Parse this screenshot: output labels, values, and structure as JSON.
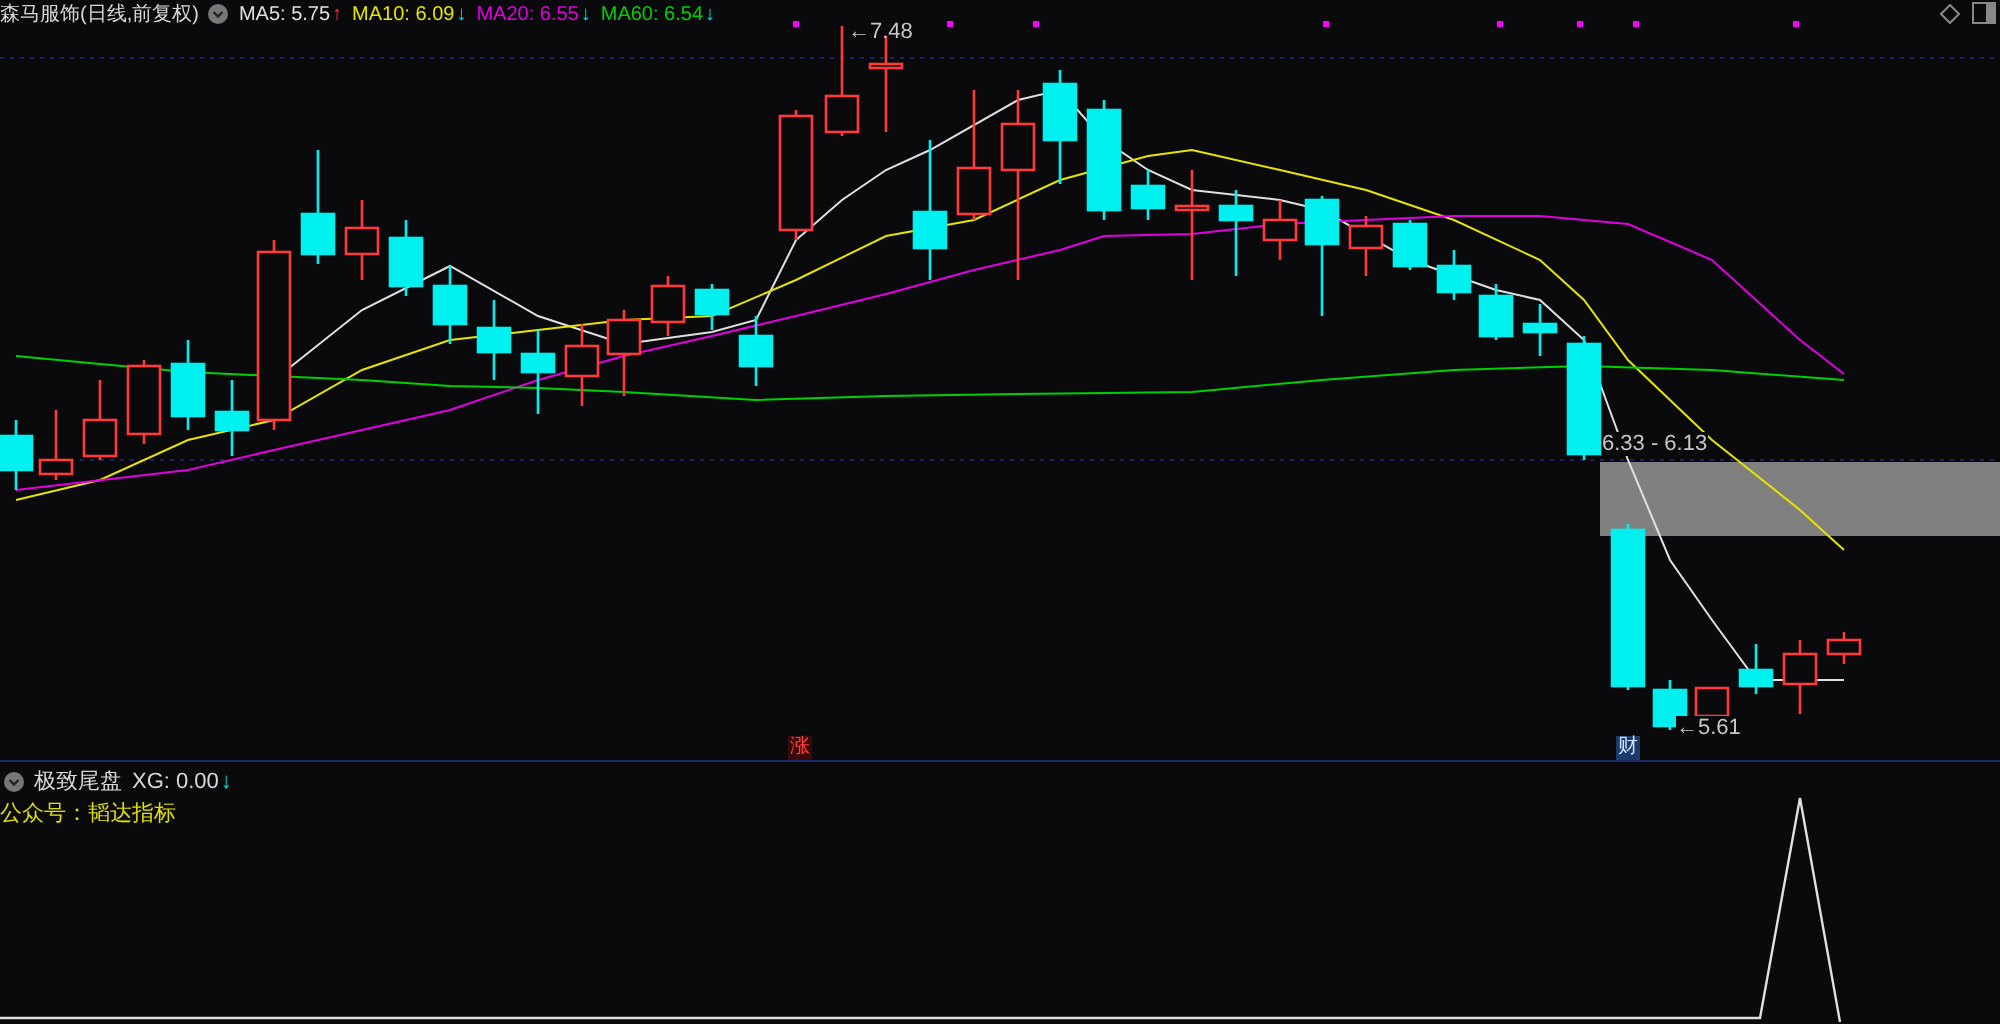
{
  "chart_header": {
    "title": "森马服饰(日线,前复权)",
    "indicators": [
      {
        "label": "MA5: 5.75",
        "arrow": "↑",
        "rising": true,
        "color": "#e0e0e0"
      },
      {
        "label": "MA10: 6.09",
        "arrow": "↓",
        "rising": false,
        "color": "#e5e500"
      },
      {
        "label": "MA20: 6.55",
        "arrow": "↓",
        "rising": false,
        "color": "#e000e0"
      },
      {
        "label": "MA60: 6.54",
        "arrow": "↓",
        "rising": false,
        "color": "#00d000"
      }
    ]
  },
  "price_labels": {
    "high": "←7.48",
    "low": "←5.61",
    "zone": "6.33 - 6.13"
  },
  "event_badges": [
    {
      "text": "涨",
      "kind": "rise"
    },
    {
      "text": "财",
      "kind": "finance"
    }
  ],
  "sub_panel": {
    "name": "极致尾盘",
    "reading": "XG: 0.00",
    "arrow": "↓",
    "rising": false,
    "note": "公众号：韬达指标"
  }
}
